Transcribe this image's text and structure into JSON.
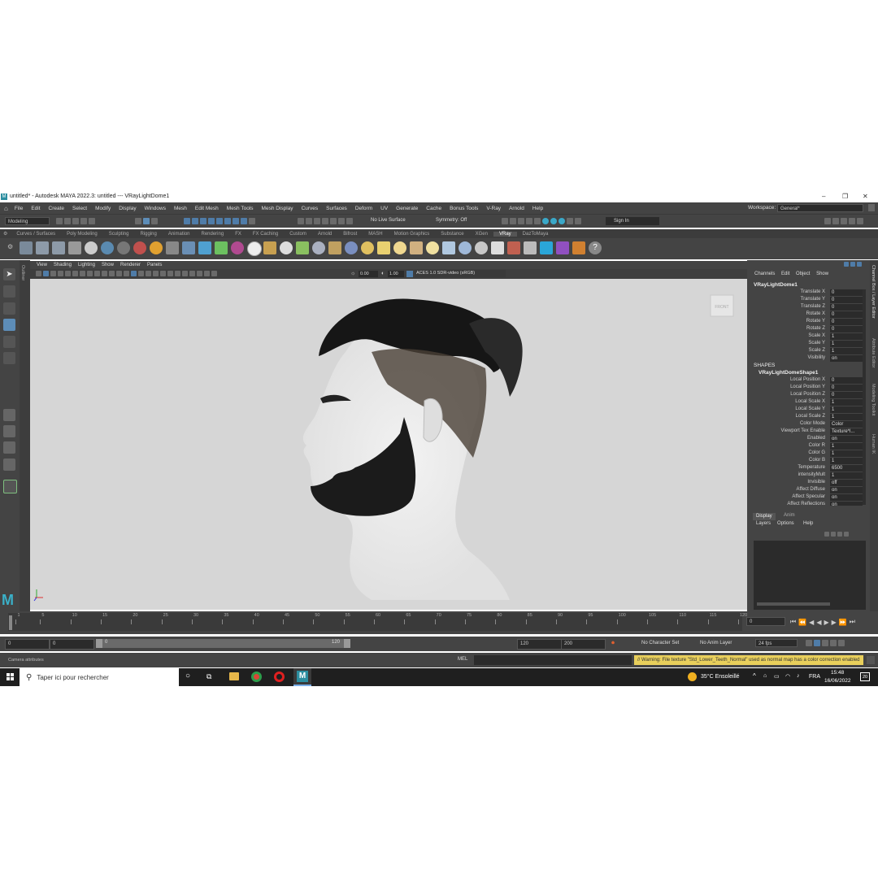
{
  "window": {
    "title": "untitled* - Autodesk MAYA 2022.3: untitled   ---   VRayLightDome1",
    "minimize": "–",
    "maximize": "❐",
    "close": "✕"
  },
  "menu": {
    "items": [
      "File",
      "Edit",
      "Create",
      "Select",
      "Modify",
      "Display",
      "Windows",
      "Mesh",
      "Edit Mesh",
      "Mesh Tools",
      "Mesh Display",
      "Curves",
      "Surfaces",
      "Deform",
      "UV",
      "Generate",
      "Cache",
      "Bonus Tools",
      "V-Ray",
      "Arnold",
      "Help"
    ],
    "workspace_label": "Workspace:",
    "workspace_value": "General*"
  },
  "status": {
    "mode": "Modeling",
    "live_surface": "No Live Surface",
    "symmetry": "Symmetry: Off",
    "sign_in": "Sign In"
  },
  "shelf": {
    "tabs": [
      "Curves / Surfaces",
      "Poly Modeling",
      "Sculpting",
      "Rigging",
      "Animation",
      "Rendering",
      "FX",
      "FX Caching",
      "Custom",
      "Arnold",
      "Bifrost",
      "MASH",
      "Motion Graphics",
      "Substance",
      "XGen",
      "VRay",
      "DazToMaya"
    ],
    "active_tab": "VRay"
  },
  "viewport": {
    "menu": [
      "View",
      "Shading",
      "Lighting",
      "Show",
      "Renderer",
      "Panels"
    ],
    "exposure": "0.00",
    "gamma": "1.00",
    "color_space": "ACES 1.0 SDR-video (sRGB)",
    "cube_label": "FRONT"
  },
  "outliner_label": "Outliner",
  "channel_box": {
    "tabs": [
      "Channels",
      "Edit",
      "Object",
      "Show"
    ],
    "object_name": "VRayLightDome1",
    "transform": [
      {
        "label": "Translate X",
        "value": "0"
      },
      {
        "label": "Translate Y",
        "value": "0"
      },
      {
        "label": "Translate Z",
        "value": "0"
      },
      {
        "label": "Rotate X",
        "value": "0"
      },
      {
        "label": "Rotate Y",
        "value": "0"
      },
      {
        "label": "Rotate Z",
        "value": "0"
      },
      {
        "label": "Scale X",
        "value": "1"
      },
      {
        "label": "Scale Y",
        "value": "1"
      },
      {
        "label": "Scale Z",
        "value": "1"
      },
      {
        "label": "Visibility",
        "value": "on"
      }
    ],
    "shapes_header": "SHAPES",
    "shape_name": "VRayLightDomeShape1",
    "shape_attrs": [
      {
        "label": "Local Position X",
        "value": "0"
      },
      {
        "label": "Local Position Y",
        "value": "0"
      },
      {
        "label": "Local Position Z",
        "value": "0"
      },
      {
        "label": "Local Scale X",
        "value": "1"
      },
      {
        "label": "Local Scale Y",
        "value": "1"
      },
      {
        "label": "Local Scale Z",
        "value": "1"
      },
      {
        "label": "Color Mode",
        "value": "Color"
      },
      {
        "label": "Viewport Tex Enable",
        "value": "Texture*l..."
      },
      {
        "label": "Enabled",
        "value": "on"
      },
      {
        "label": "Color R",
        "value": "1"
      },
      {
        "label": "Color G",
        "value": "1"
      },
      {
        "label": "Color B",
        "value": "1"
      },
      {
        "label": "Temperature",
        "value": "6500"
      },
      {
        "label": "intensityMult",
        "value": "1"
      },
      {
        "label": "Invisible",
        "value": "off"
      },
      {
        "label": "Affect Diffuse",
        "value": "on"
      },
      {
        "label": "Affect Specular",
        "value": "on"
      },
      {
        "label": "Affect Reflections",
        "value": "on"
      }
    ],
    "side_tabs": [
      "Channel Box / Layer Editor",
      "Attribute Editor",
      "Modeling Toolkit",
      "Human IK"
    ]
  },
  "layer_editor": {
    "tabs": [
      "Display",
      "Anim"
    ],
    "menu": [
      "Layers",
      "Options",
      "Help"
    ]
  },
  "timeline": {
    "ticks": [
      "1",
      "5",
      "10",
      "15",
      "20",
      "25",
      "30",
      "35",
      "40",
      "45",
      "50",
      "55",
      "60",
      "65",
      "70",
      "75",
      "80",
      "85",
      "90",
      "95",
      "100",
      "105",
      "110",
      "115",
      "120"
    ],
    "current_frame": "0",
    "start": "0",
    "range_start": "0",
    "slider_start": "0",
    "slider_end": "120",
    "range_end": "120",
    "end": "200",
    "character_set": "No Character Set",
    "anim_layer": "No Anim Layer",
    "fps": "24 fps"
  },
  "command": {
    "help": "Camera attributes",
    "lang": "MEL",
    "warning": "// Warning: File texture \"Std_Lower_Teeth_Normal\" used as normal map has a color correction enabled"
  },
  "taskbar": {
    "search_placeholder": "Taper ici pour rechercher",
    "weather": "35°C  Ensoleillé",
    "lang": "FRA",
    "time": "15:48",
    "date": "16/06/2022",
    "notif": "20"
  }
}
